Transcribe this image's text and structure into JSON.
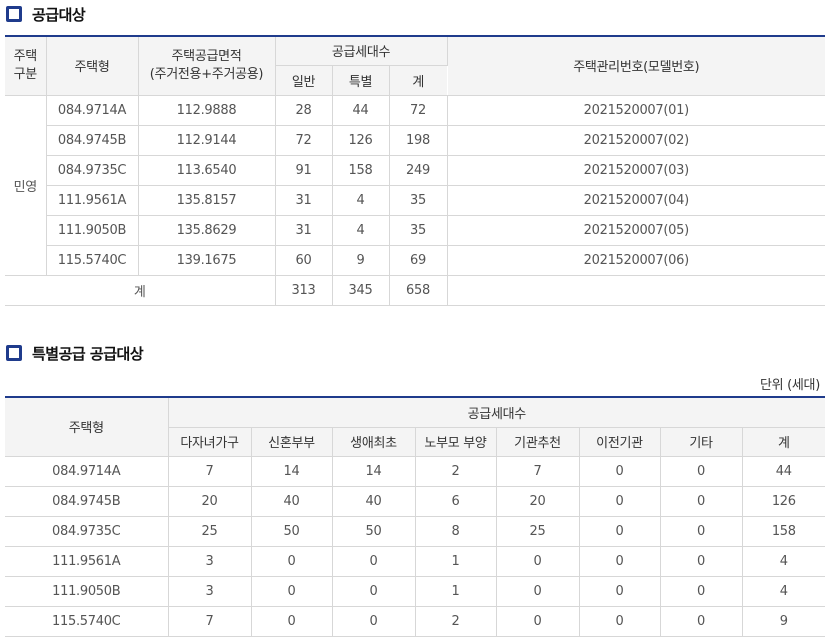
{
  "section1": {
    "title": "공급대상",
    "header": {
      "type_group_line1": "주택",
      "type_group_line2": "구분",
      "house_type": "주택형",
      "area_line1": "주택공급면적",
      "area_line2": "(주거전용+주거공용)",
      "supply_units": "공급세대수",
      "general": "일반",
      "special": "특별",
      "total": "계",
      "mgmt_no": "주택관리번호(모델번호)"
    },
    "group_label": "민영",
    "rows": [
      {
        "type": "084.9714A",
        "area": "112.9888",
        "general": "28",
        "special": "44",
        "total": "72",
        "mgmt": "2021520007(01)"
      },
      {
        "type": "084.9745B",
        "area": "112.9144",
        "general": "72",
        "special": "126",
        "total": "198",
        "mgmt": "2021520007(02)"
      },
      {
        "type": "084.9735C",
        "area": "113.6540",
        "general": "91",
        "special": "158",
        "total": "249",
        "mgmt": "2021520007(03)"
      },
      {
        "type": "111.9561A",
        "area": "135.8157",
        "general": "31",
        "special": "4",
        "total": "35",
        "mgmt": "2021520007(04)"
      },
      {
        "type": "111.9050B",
        "area": "135.8629",
        "general": "31",
        "special": "4",
        "total": "35",
        "mgmt": "2021520007(05)"
      },
      {
        "type": "115.5740C",
        "area": "139.1675",
        "general": "60",
        "special": "9",
        "total": "69",
        "mgmt": "2021520007(06)"
      }
    ],
    "total_row": {
      "label": "계",
      "general": "313",
      "special": "345",
      "total": "658"
    }
  },
  "section2": {
    "title": "특별공급 공급대상",
    "unit": "단위 (세대)",
    "header": {
      "house_type": "주택형",
      "supply_units": "공급세대수",
      "columns": [
        "다자녀가구",
        "신혼부부",
        "생애최초",
        "노부모 부양",
        "기관추천",
        "이전기관",
        "기타",
        "계"
      ]
    },
    "rows": [
      {
        "type": "084.9714A",
        "values": [
          "7",
          "14",
          "14",
          "2",
          "7",
          "0",
          "0",
          "44"
        ]
      },
      {
        "type": "084.9745B",
        "values": [
          "20",
          "40",
          "40",
          "6",
          "20",
          "0",
          "0",
          "126"
        ]
      },
      {
        "type": "084.9735C",
        "values": [
          "25",
          "50",
          "50",
          "8",
          "25",
          "0",
          "0",
          "158"
        ]
      },
      {
        "type": "111.9561A",
        "values": [
          "3",
          "0",
          "0",
          "1",
          "0",
          "0",
          "0",
          "4"
        ]
      },
      {
        "type": "111.9050B",
        "values": [
          "3",
          "0",
          "0",
          "1",
          "0",
          "0",
          "0",
          "4"
        ]
      },
      {
        "type": "115.5740C",
        "values": [
          "7",
          "0",
          "0",
          "2",
          "0",
          "0",
          "0",
          "9"
        ]
      }
    ]
  },
  "colors": {
    "accent": "#1f3b8c",
    "header_bg": "#f4f4f4",
    "border": "#d7d7d7"
  }
}
